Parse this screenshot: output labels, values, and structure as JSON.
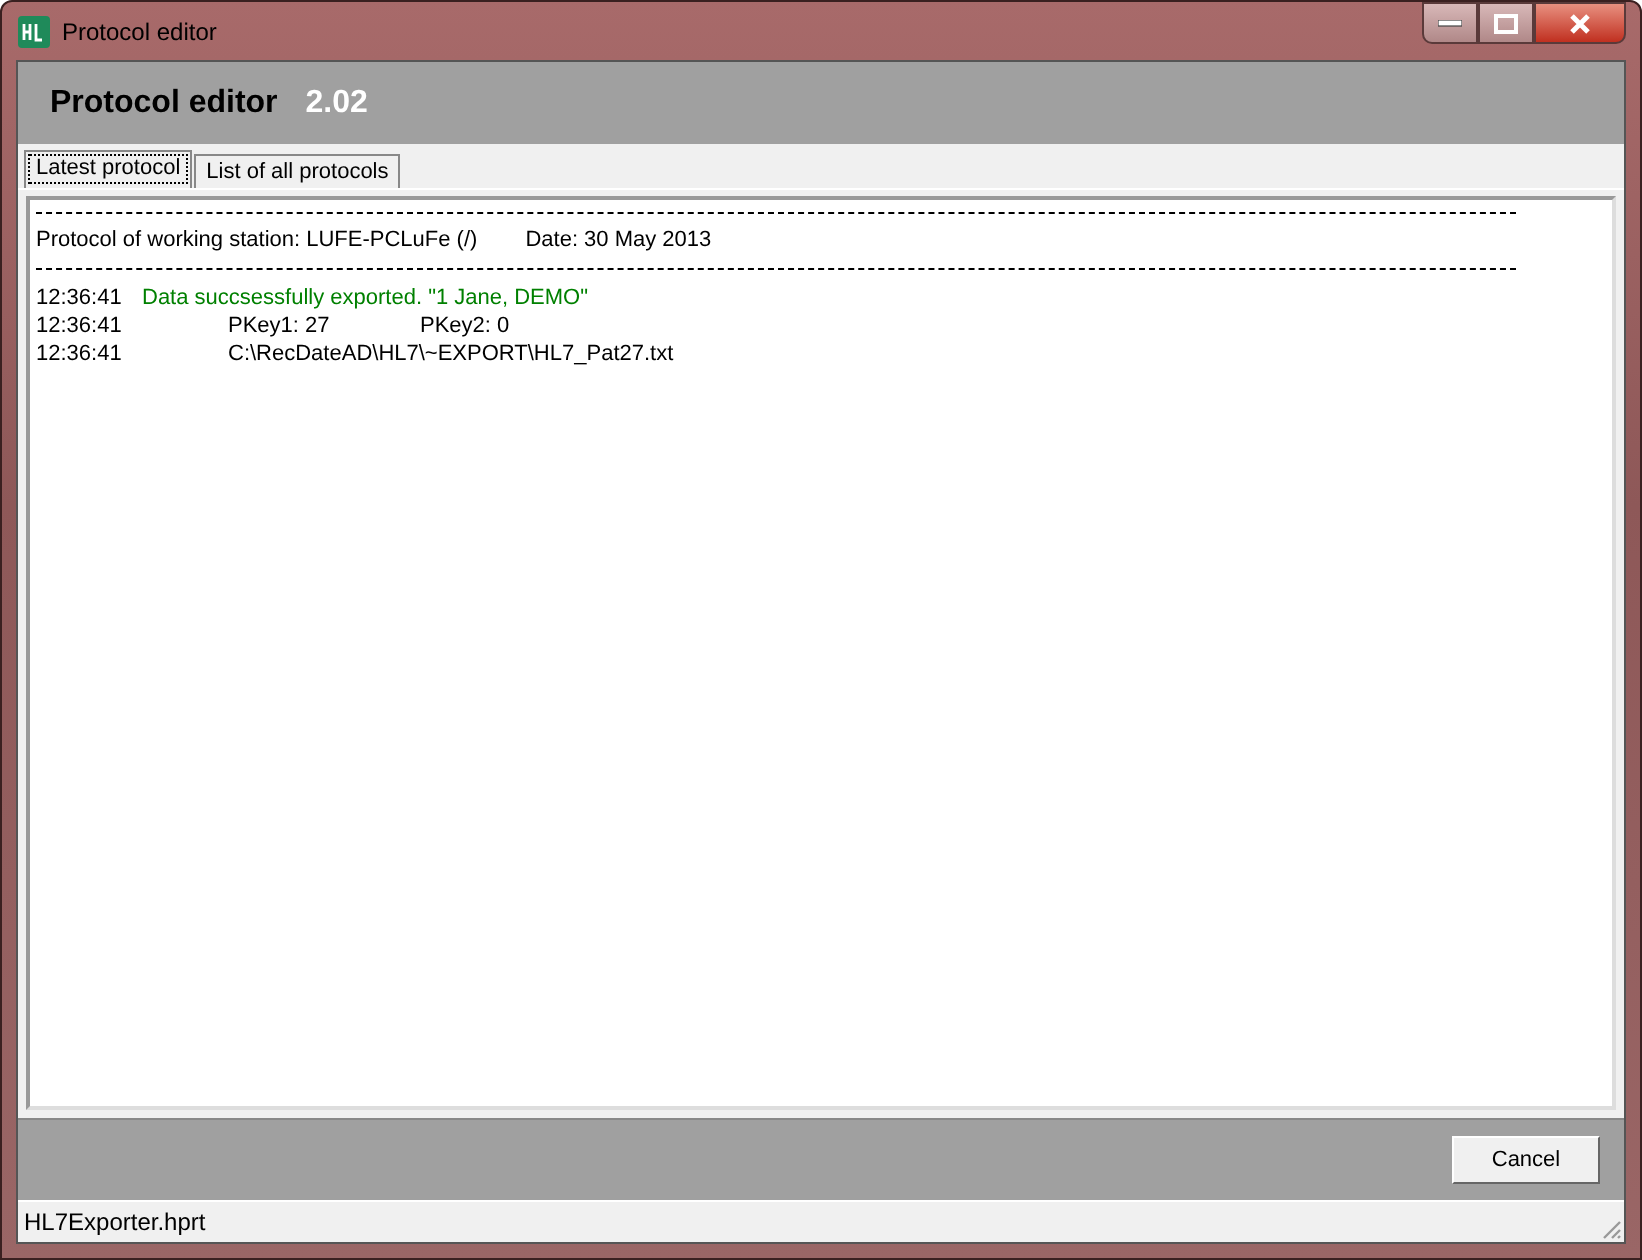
{
  "window": {
    "title": "Protocol editor"
  },
  "header": {
    "title": "Protocol editor",
    "version": "2.02"
  },
  "tabs": [
    {
      "label": "Latest protocol",
      "selected": true
    },
    {
      "label": "List of all protocols",
      "selected": false
    }
  ],
  "protocol": {
    "station_line": "Protocol of working station: LUFE-PCLuFe (/)",
    "date_line": "Date:  30 May 2013",
    "entries": [
      {
        "time": "12:36:41",
        "kind": "success",
        "parts": [
          "Data succsessfully exported. \"1 Jane, DEMO\""
        ]
      },
      {
        "time": "12:36:41",
        "kind": "detail",
        "parts": [
          "PKey1: 27",
          "PKey2: 0"
        ]
      },
      {
        "time": "12:36:41",
        "kind": "detail",
        "parts": [
          "C:\\RecDateAD\\HL7\\~EXPORT\\HL7_Pat27.txt"
        ]
      }
    ]
  },
  "buttons": [
    "Cancel"
  ],
  "status_bar": "HL7Exporter.hprt"
}
